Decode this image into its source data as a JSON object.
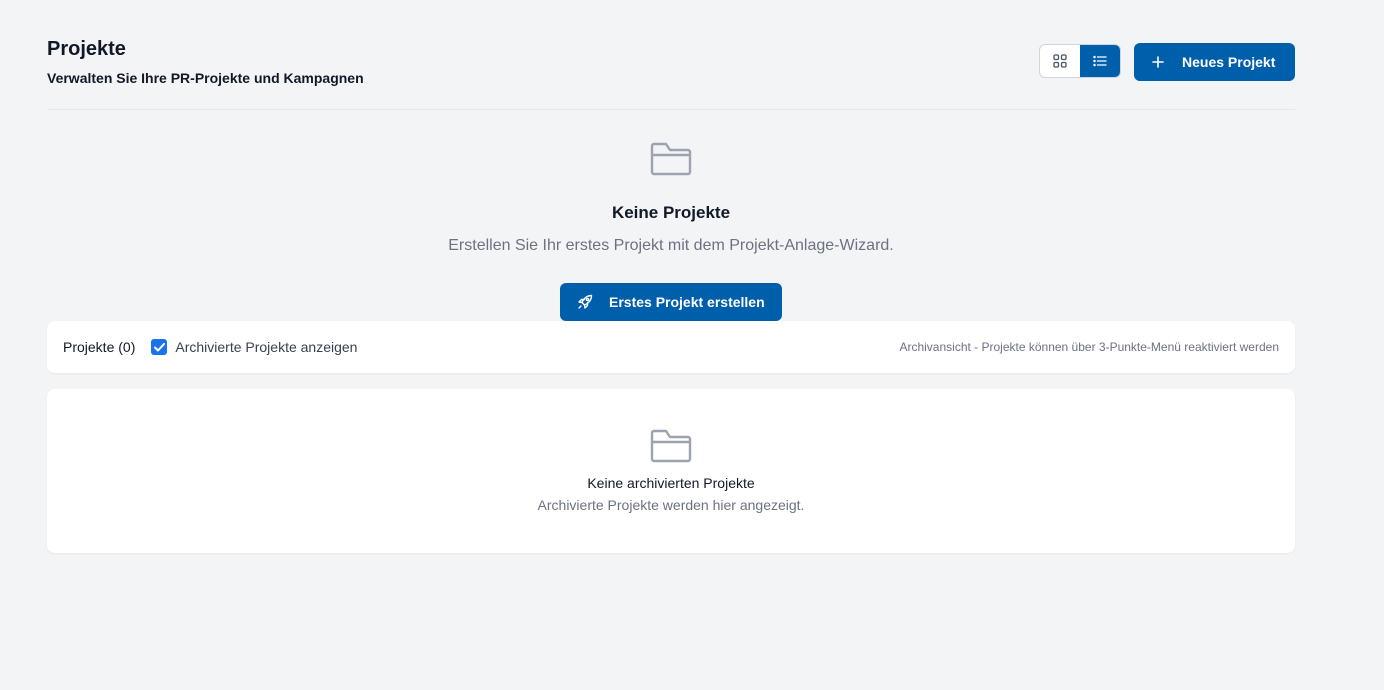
{
  "header": {
    "title": "Projekte",
    "subtitle": "Verwalten Sie Ihre PR-Projekte und Kampagnen",
    "view_toggle": {
      "grid_icon": "grid-icon",
      "list_icon": "list-icon",
      "active": "list"
    },
    "new_project_label": "Neues Projekt"
  },
  "empty_state": {
    "icon": "folder-icon",
    "title": "Keine Projekte",
    "description": "Erstellen Sie Ihr erstes Projekt mit dem Projekt-Anlage-Wizard.",
    "button_icon": "rocket-icon",
    "button_label": "Erstes Projekt erstellen"
  },
  "filter_bar": {
    "count_label": "Projekte (0)",
    "show_archived_checked": true,
    "show_archived_label": "Archivierte Projekte anzeigen",
    "hint": "Archivansicht - Projekte können über 3-Punkte-Menü reaktiviert werden"
  },
  "archive": {
    "icon": "folder-icon",
    "title": "Keine archivierten Projekte",
    "description": "Archivierte Projekte werden hier angezeigt."
  },
  "colors": {
    "primary": "#005fab",
    "checkbox": "#1a73e8",
    "background": "#f3f4f6",
    "muted_text": "#6b7280"
  }
}
